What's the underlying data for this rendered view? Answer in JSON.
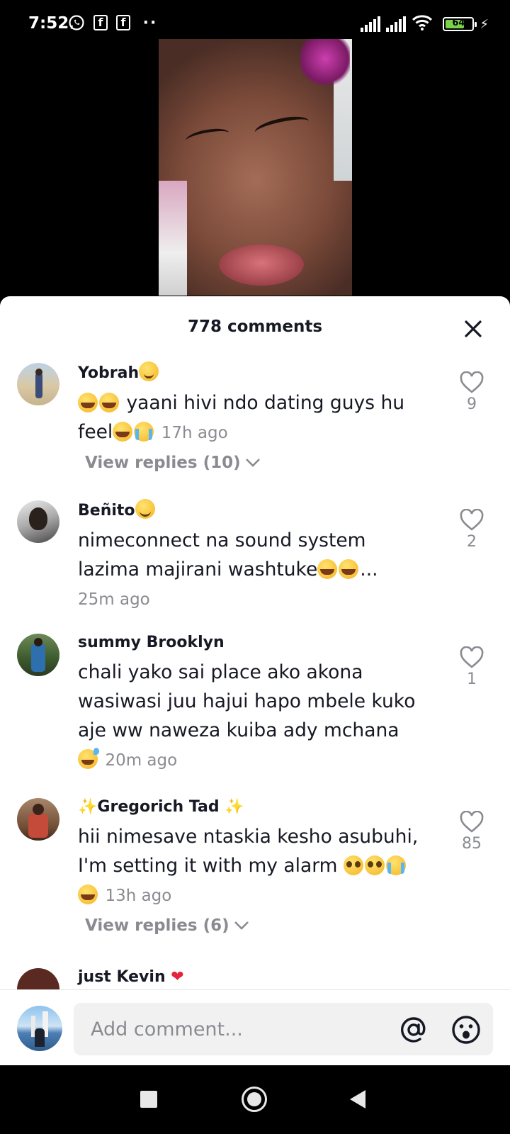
{
  "status_bar": {
    "time": "7:52",
    "notification_icons": [
      "whatsapp-icon",
      "facebook-icon",
      "facebook-icon",
      "more-dots-icon"
    ],
    "battery_level": "64"
  },
  "comments_sheet": {
    "title": "778 comments",
    "comments": [
      {
        "username": "Yobrah",
        "name_emoji": "slightly-smiling-face",
        "text": "yaani hivi ndo dating guys hu feel",
        "time": "17h ago",
        "likes": "9",
        "view_replies": "View replies (10)"
      },
      {
        "username": "Beñito",
        "name_emoji": "winking-face",
        "text_line1": "nimeconnect na sound system",
        "text_line2": "lazima majirani washtuke",
        "text_ellipsis": "...",
        "time": "25m ago",
        "likes": "2"
      },
      {
        "username": "summy Brooklyn",
        "text": "chali yako sai place ako akona wasiwasi juu hajui hapo mbele kuko aje ww naweza kuiba ady mchana",
        "time": "20m ago",
        "likes": "1"
      },
      {
        "username": "Gregorich Tad",
        "text": "hii nimesave ntaskia kesho asubuhi, I'm setting it with my alarm",
        "time": "13h ago",
        "likes": "85",
        "view_replies": "View replies (6)"
      },
      {
        "username": "just Kevin"
      }
    ]
  },
  "comment_input": {
    "placeholder": "Add comment..."
  },
  "colors": {
    "text_primary": "#161823",
    "text_secondary": "#8a8b91",
    "battery_fill": "#7ad14a"
  }
}
